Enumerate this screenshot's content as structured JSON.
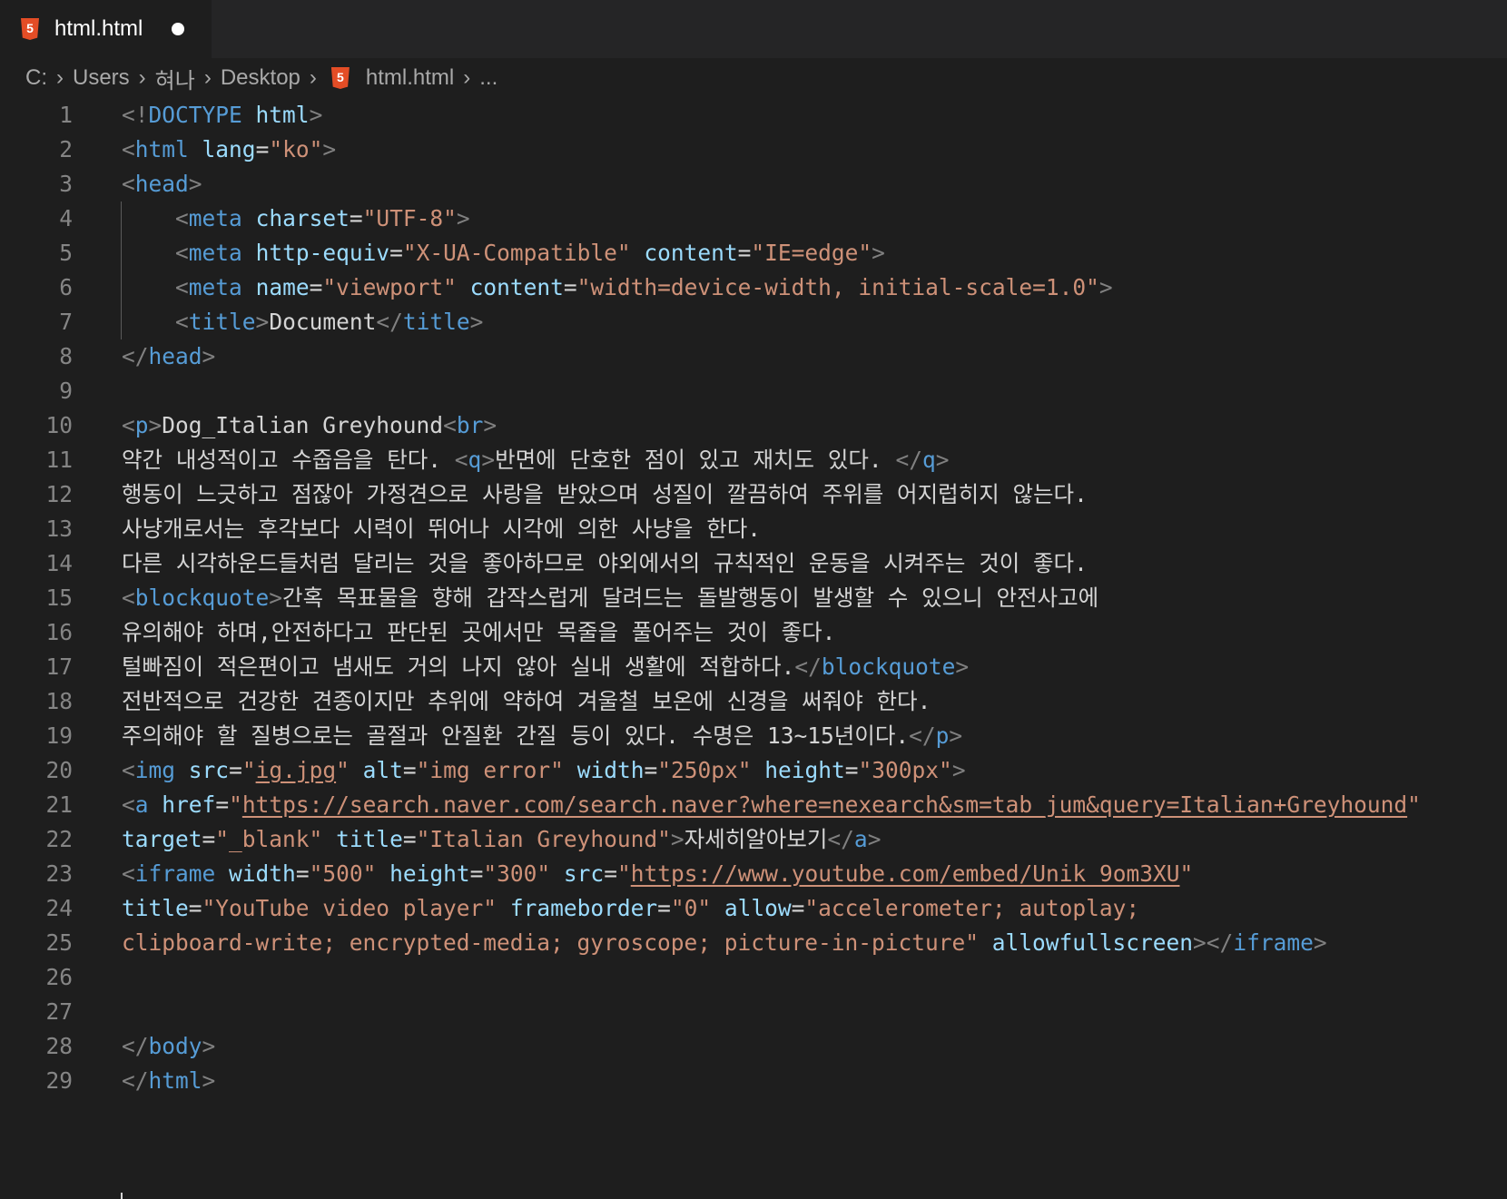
{
  "tab": {
    "label": "html.html"
  },
  "breadcrumb": [
    "C:",
    "Users",
    "혀나",
    "Desktop",
    "html.html",
    "..."
  ],
  "icons": {
    "file": "html5-icon",
    "unsaved": "dot-icon",
    "separator": "chevron-right-icon"
  },
  "colors": {
    "tag": "#569cd6",
    "attribute": "#9cdcfe",
    "string": "#ce9178",
    "text": "#d4d4d4",
    "punctuation": "#808080",
    "line_number": "#858585",
    "background": "#1e1e1e"
  },
  "lines": [
    [
      [
        "p",
        "<!"
      ],
      [
        "tag",
        "DOCTYPE"
      ],
      [
        "t",
        " "
      ],
      [
        "attr",
        "html"
      ],
      [
        "p",
        ">"
      ]
    ],
    [
      [
        "p",
        "<"
      ],
      [
        "tag",
        "html"
      ],
      [
        "t",
        " "
      ],
      [
        "attr",
        "lang"
      ],
      [
        "t",
        "="
      ],
      [
        "str",
        "\"ko\""
      ],
      [
        "p",
        ">"
      ]
    ],
    [
      [
        "p",
        "<"
      ],
      [
        "tag",
        "head"
      ],
      [
        "p",
        ">"
      ]
    ],
    [
      [
        "t",
        "    "
      ],
      [
        "p",
        "<"
      ],
      [
        "tag",
        "meta"
      ],
      [
        "t",
        " "
      ],
      [
        "attr",
        "charset"
      ],
      [
        "t",
        "="
      ],
      [
        "str",
        "\"UTF-8\""
      ],
      [
        "p",
        ">"
      ]
    ],
    [
      [
        "t",
        "    "
      ],
      [
        "p",
        "<"
      ],
      [
        "tag",
        "meta"
      ],
      [
        "t",
        " "
      ],
      [
        "attr",
        "http-equiv"
      ],
      [
        "t",
        "="
      ],
      [
        "str",
        "\"X-UA-Compatible\""
      ],
      [
        "t",
        " "
      ],
      [
        "attr",
        "content"
      ],
      [
        "t",
        "="
      ],
      [
        "str",
        "\"IE=edge\""
      ],
      [
        "p",
        ">"
      ]
    ],
    [
      [
        "t",
        "    "
      ],
      [
        "p",
        "<"
      ],
      [
        "tag",
        "meta"
      ],
      [
        "t",
        " "
      ],
      [
        "attr",
        "name"
      ],
      [
        "t",
        "="
      ],
      [
        "str",
        "\"viewport\""
      ],
      [
        "t",
        " "
      ],
      [
        "attr",
        "content"
      ],
      [
        "t",
        "="
      ],
      [
        "str",
        "\"width=device-width, initial-scale=1.0\""
      ],
      [
        "p",
        ">"
      ]
    ],
    [
      [
        "t",
        "    "
      ],
      [
        "p",
        "<"
      ],
      [
        "tag",
        "title"
      ],
      [
        "p",
        ">"
      ],
      [
        "t",
        "Document"
      ],
      [
        "p",
        "</"
      ],
      [
        "tag",
        "title"
      ],
      [
        "p",
        ">"
      ]
    ],
    [
      [
        "p",
        "</"
      ],
      [
        "tag",
        "head"
      ],
      [
        "p",
        ">"
      ]
    ],
    [],
    [
      [
        "p",
        "<"
      ],
      [
        "tag",
        "p"
      ],
      [
        "p",
        ">"
      ],
      [
        "t",
        "Dog_Italian Greyhound"
      ],
      [
        "p",
        "<"
      ],
      [
        "tag",
        "br"
      ],
      [
        "p",
        ">"
      ]
    ],
    [
      [
        "t",
        "약간 내성적이고 수줍음을 탄다. "
      ],
      [
        "p",
        "<"
      ],
      [
        "tag",
        "q"
      ],
      [
        "p",
        ">"
      ],
      [
        "t",
        "반면에 단호한 점이 있고 재치도 있다. "
      ],
      [
        "p",
        "</"
      ],
      [
        "tag",
        "q"
      ],
      [
        "p",
        ">"
      ]
    ],
    [
      [
        "t",
        "행동이 느긋하고 점잖아 가정견으로 사랑을 받았으며 성질이 깔끔하여 주위를 어지럽히지 않는다."
      ]
    ],
    [
      [
        "t",
        "사냥개로서는 후각보다 시력이 뛰어나 시각에 의한 사냥을 한다."
      ]
    ],
    [
      [
        "t",
        "다른 시각하운드들처럼 달리는 것을 좋아하므로 야외에서의 규칙적인 운동을 시켜주는 것이 좋다."
      ]
    ],
    [
      [
        "p",
        "<"
      ],
      [
        "tag",
        "blockquote"
      ],
      [
        "p",
        ">"
      ],
      [
        "t",
        "간혹 목표물을 향해 갑작스럽게 달려드는 돌발행동이 발생할 수 있으니 안전사고에"
      ]
    ],
    [
      [
        "t",
        "유의해야 하며,안전하다고 판단된 곳에서만 목줄을 풀어주는 것이 좋다."
      ]
    ],
    [
      [
        "t",
        "털빠짐이 적은편이고 냄새도 거의 나지 않아 실내 생활에 적합하다."
      ],
      [
        "p",
        "</"
      ],
      [
        "tag",
        "blockquote"
      ],
      [
        "p",
        ">"
      ]
    ],
    [
      [
        "t",
        "전반적으로 건강한 견종이지만 추위에 약하여 겨울철 보온에 신경을 써줘야 한다."
      ]
    ],
    [
      [
        "t",
        "주의해야 할 질병으로는 골절과 안질환 간질 등이 있다. 수명은 13~15년이다."
      ],
      [
        "p",
        "</"
      ],
      [
        "tag",
        "p"
      ],
      [
        "p",
        ">"
      ]
    ],
    [
      [
        "p",
        "<"
      ],
      [
        "tag",
        "img"
      ],
      [
        "t",
        " "
      ],
      [
        "attr",
        "src"
      ],
      [
        "t",
        "="
      ],
      [
        "str",
        "\""
      ],
      [
        "url",
        "ig.jpg"
      ],
      [
        "str",
        "\""
      ],
      [
        "t",
        " "
      ],
      [
        "attr",
        "alt"
      ],
      [
        "t",
        "="
      ],
      [
        "str",
        "\"img error\""
      ],
      [
        "t",
        " "
      ],
      [
        "attr",
        "width"
      ],
      [
        "t",
        "="
      ],
      [
        "str",
        "\"250px\""
      ],
      [
        "t",
        " "
      ],
      [
        "attr",
        "height"
      ],
      [
        "t",
        "="
      ],
      [
        "str",
        "\"300px\""
      ],
      [
        "p",
        ">"
      ]
    ],
    [
      [
        "p",
        "<"
      ],
      [
        "tag",
        "a"
      ],
      [
        "t",
        " "
      ],
      [
        "attr",
        "href"
      ],
      [
        "t",
        "="
      ],
      [
        "str",
        "\""
      ],
      [
        "url",
        "https://search.naver.com/search.naver?where=nexearch&sm=tab_jum&query=Italian+Greyhound"
      ],
      [
        "str",
        "\""
      ]
    ],
    [
      [
        "attr",
        "target"
      ],
      [
        "t",
        "="
      ],
      [
        "str",
        "\"_blank\""
      ],
      [
        "t",
        " "
      ],
      [
        "attr",
        "title"
      ],
      [
        "t",
        "="
      ],
      [
        "str",
        "\"Italian Greyhound\""
      ],
      [
        "p",
        ">"
      ],
      [
        "t",
        "자세히알아보기"
      ],
      [
        "p",
        "</"
      ],
      [
        "tag",
        "a"
      ],
      [
        "p",
        ">"
      ]
    ],
    [
      [
        "p",
        "<"
      ],
      [
        "tag",
        "iframe"
      ],
      [
        "t",
        " "
      ],
      [
        "attr",
        "width"
      ],
      [
        "t",
        "="
      ],
      [
        "str",
        "\"500\""
      ],
      [
        "t",
        " "
      ],
      [
        "attr",
        "height"
      ],
      [
        "t",
        "="
      ],
      [
        "str",
        "\"300\""
      ],
      [
        "t",
        " "
      ],
      [
        "attr",
        "src"
      ],
      [
        "t",
        "="
      ],
      [
        "str",
        "\""
      ],
      [
        "url",
        "https://www.youtube.com/embed/Unik_9om3XU"
      ],
      [
        "str",
        "\""
      ]
    ],
    [
      [
        "attr",
        "title"
      ],
      [
        "t",
        "="
      ],
      [
        "str",
        "\"YouTube video player\""
      ],
      [
        "t",
        " "
      ],
      [
        "attr",
        "frameborder"
      ],
      [
        "t",
        "="
      ],
      [
        "str",
        "\"0\""
      ],
      [
        "t",
        " "
      ],
      [
        "attr",
        "allow"
      ],
      [
        "t",
        "="
      ],
      [
        "str",
        "\"accelerometer; autoplay;"
      ]
    ],
    [
      [
        "str",
        "clipboard-write; encrypted-media; gyroscope; picture-in-picture\""
      ],
      [
        "t",
        " "
      ],
      [
        "attr",
        "allowfullscreen"
      ],
      [
        "p",
        "></"
      ],
      [
        "tag",
        "iframe"
      ],
      [
        "p",
        ">"
      ]
    ],
    [],
    [],
    [
      [
        "p",
        "</"
      ],
      [
        "tag",
        "body"
      ],
      [
        "p",
        ">"
      ]
    ],
    [
      [
        "p",
        "</"
      ],
      [
        "tag",
        "html"
      ],
      [
        "p",
        ">"
      ]
    ]
  ]
}
